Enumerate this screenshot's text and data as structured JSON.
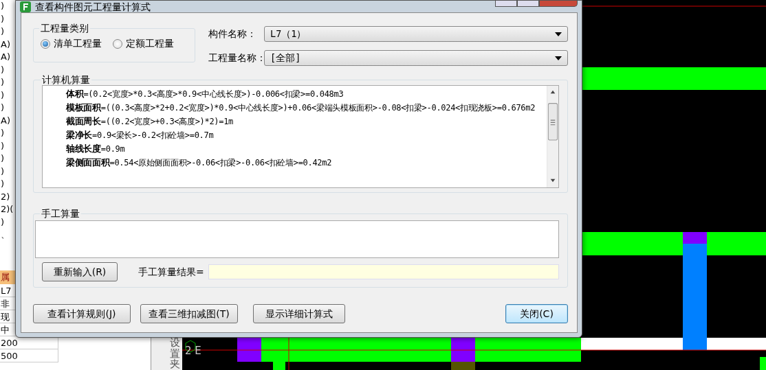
{
  "background": {
    "list_fragments": [
      ")",
      ")",
      ")",
      "A)",
      "A)",
      ")",
      ")",
      ")",
      ")",
      "A)",
      ")",
      ")",
      ")",
      ")",
      ")",
      "2)",
      "2)(",
      ")",
      "、"
    ],
    "property_header": "属",
    "property_rows": [
      "L7",
      "非",
      "现",
      "中",
      "200",
      "500"
    ],
    "toolbar_label": "设置夹",
    "canvas_label": "2 E"
  },
  "dialog": {
    "title": "查看构件图元工程量计算式",
    "quantity_type": {
      "legend": "工程量类别",
      "options": [
        {
          "label": "清单工程量",
          "selected": true
        },
        {
          "label": "定额工程量",
          "selected": false
        }
      ]
    },
    "component_name": {
      "label": "构件名称：",
      "value": "L7（1）"
    },
    "quantity_name": {
      "label": "工程量名称：",
      "value": "[全部]"
    },
    "computer": {
      "legend": "计算机算量",
      "lines": [
        "**体积**=(0.2<宽度>*0.3<高度>*0.9<中心线长度>)-0.006<扣梁>=0.048m3",
        "**模板面积**=((0.3<高度>*2+0.2<宽度>)*0.9<中心线长度>)+0.06<梁端头模板面积>-0.08<扣梁>-0.024<扣现浇板>=0.676m2",
        "**截面周长**=((0.2<宽度>+0.3<高度>)*2)=1m",
        "**梁净长**=0.9<梁长>-0.2<扣砼墙>=0.7m",
        "**轴线长度**=0.9m",
        "**梁侧面面积**=0.54<原始侧面面积>-0.06<扣梁>-0.06<扣砼墙>=0.42m2"
      ]
    },
    "manual": {
      "legend": "手工算量",
      "reenter_button": "重新输入(R)",
      "result_label": "手工算量结果="
    },
    "buttons": [
      {
        "label": "查看计算规则(J)",
        "default": false
      },
      {
        "label": "查看三维扣减图(T)",
        "default": false
      },
      {
        "label": "显示详细计算式",
        "default": false
      },
      {
        "label": "关闭(C)",
        "default": true
      }
    ]
  }
}
